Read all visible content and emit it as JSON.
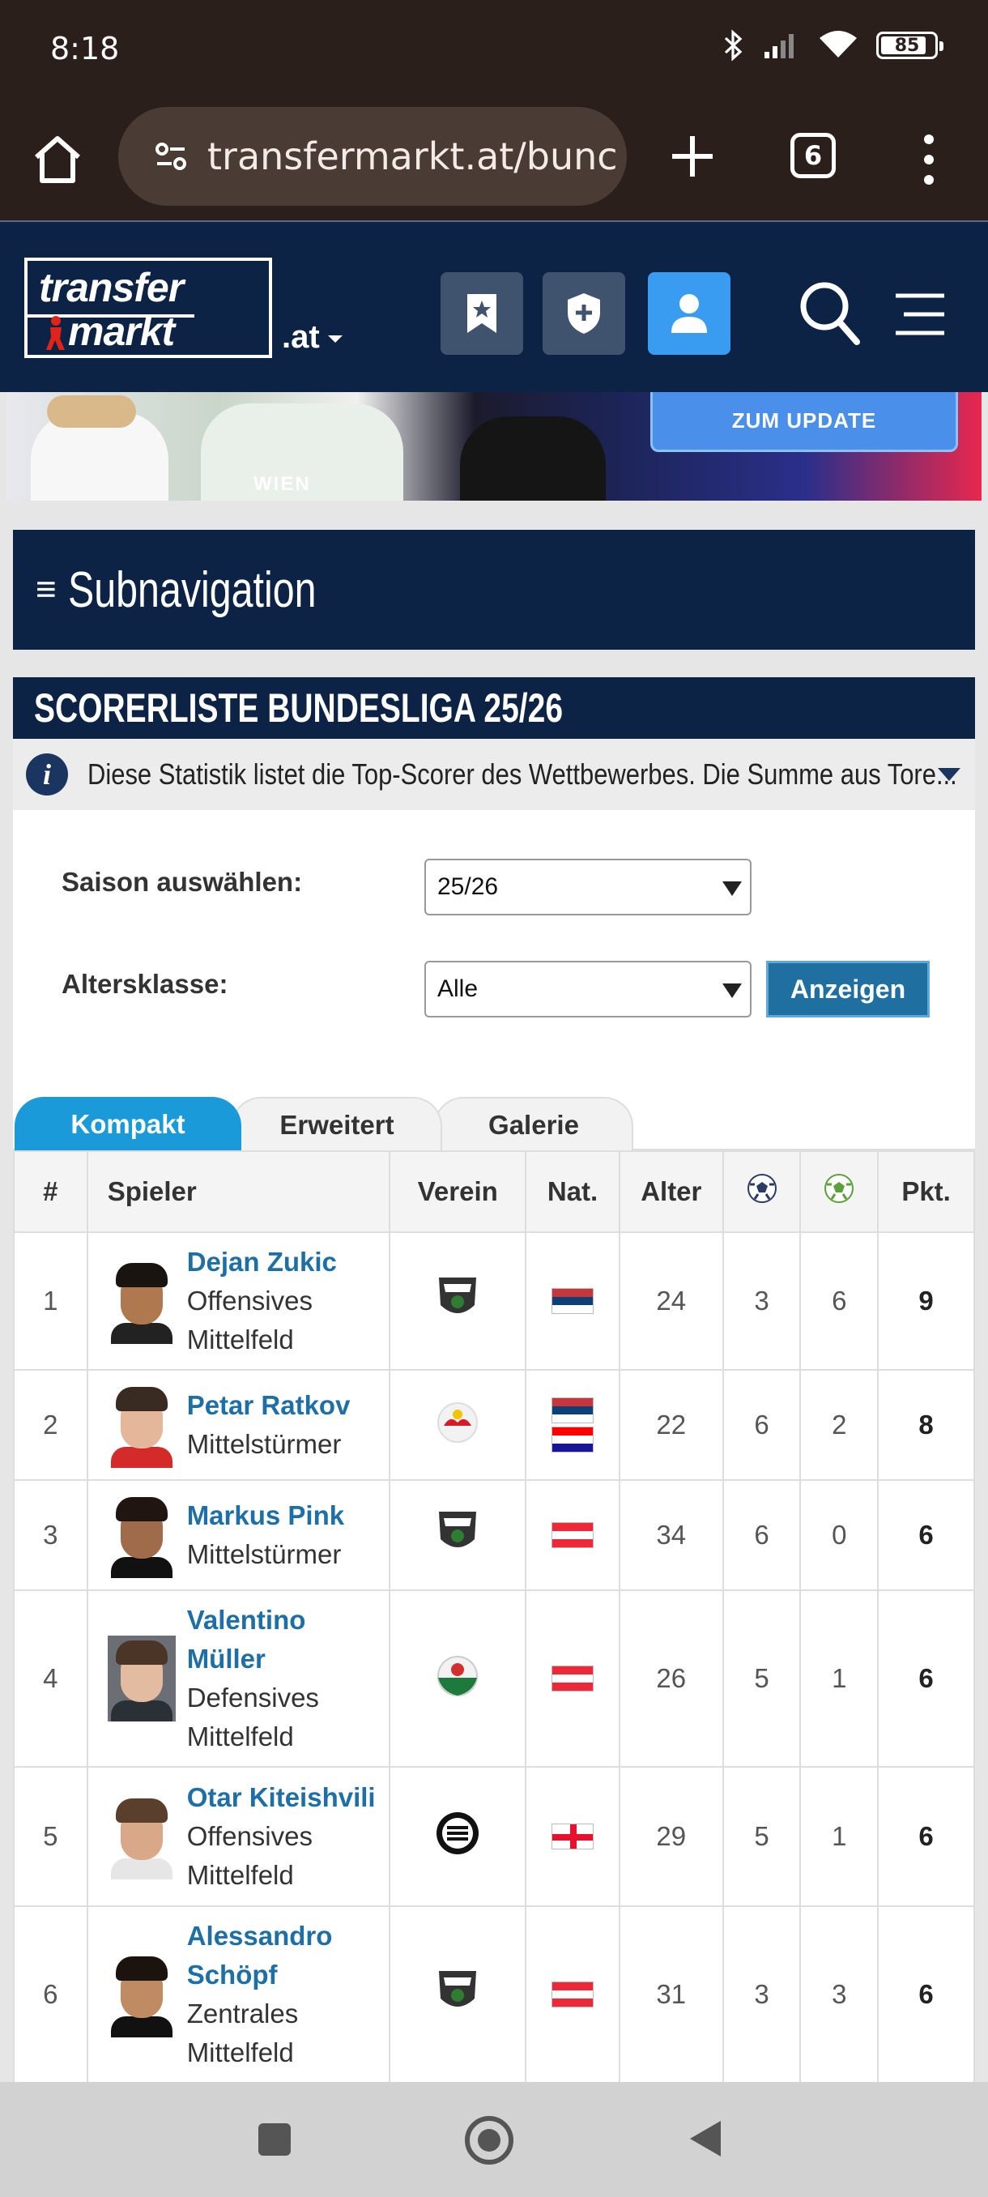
{
  "status": {
    "time": "8:18",
    "battery": "85"
  },
  "browser": {
    "url": "transfermarkt.at/bunc",
    "tab_count": "6"
  },
  "site": {
    "logo_line1": "transfer",
    "logo_line2": "markt",
    "tld": ".at"
  },
  "banner": {
    "cta": "ZUM UPDATE",
    "shirt_text": "WIEN"
  },
  "subnav": {
    "title": "Subnavigation"
  },
  "box": {
    "title": "SCORERLISTE BUNDESLIGA 25/26",
    "info": "Diese Statistik listet die Top-Scorer des Wettbewerbes. Die Summe aus Tore..."
  },
  "form": {
    "season_label": "Saison auswählen:",
    "season_value": "25/26",
    "age_label": "Altersklasse:",
    "age_value": "Alle",
    "show_button": "Anzeigen"
  },
  "tabs": [
    "Kompakt",
    "Erweitert",
    "Galerie"
  ],
  "table": {
    "headers": {
      "rank": "#",
      "player": "Spieler",
      "club": "Verein",
      "nat": "Nat.",
      "age": "Alter",
      "pts": "Pkt."
    },
    "rows": [
      {
        "rank": "1",
        "name": "Dejan Zukic",
        "pos": "Offensives Mittelfeld",
        "age": "24",
        "goals": "3",
        "assists": "6",
        "pts": "9"
      },
      {
        "rank": "2",
        "name": "Petar Ratkov",
        "pos": "Mittelstürmer",
        "age": "22",
        "goals": "6",
        "assists": "2",
        "pts": "8"
      },
      {
        "rank": "3",
        "name": "Markus Pink",
        "pos": "Mittelstürmer",
        "age": "34",
        "goals": "6",
        "assists": "0",
        "pts": "6"
      },
      {
        "rank": "4",
        "name": "Valentino Müller",
        "pos": "Defensives Mittelfeld",
        "age": "26",
        "goals": "5",
        "assists": "1",
        "pts": "6"
      },
      {
        "rank": "5",
        "name": "Otar Kiteishvili",
        "pos": "Offensives Mittelfeld",
        "age": "29",
        "goals": "5",
        "assists": "1",
        "pts": "6"
      },
      {
        "rank": "6",
        "name": "Alessandro Schöpf",
        "pos": "Zentrales Mittelfeld",
        "age": "31",
        "goals": "3",
        "assists": "3",
        "pts": "6"
      }
    ]
  },
  "colors": {
    "header_navy": "#0d2345",
    "link_blue": "#1d6fa5",
    "tab_blue": "#1a9ad8"
  }
}
